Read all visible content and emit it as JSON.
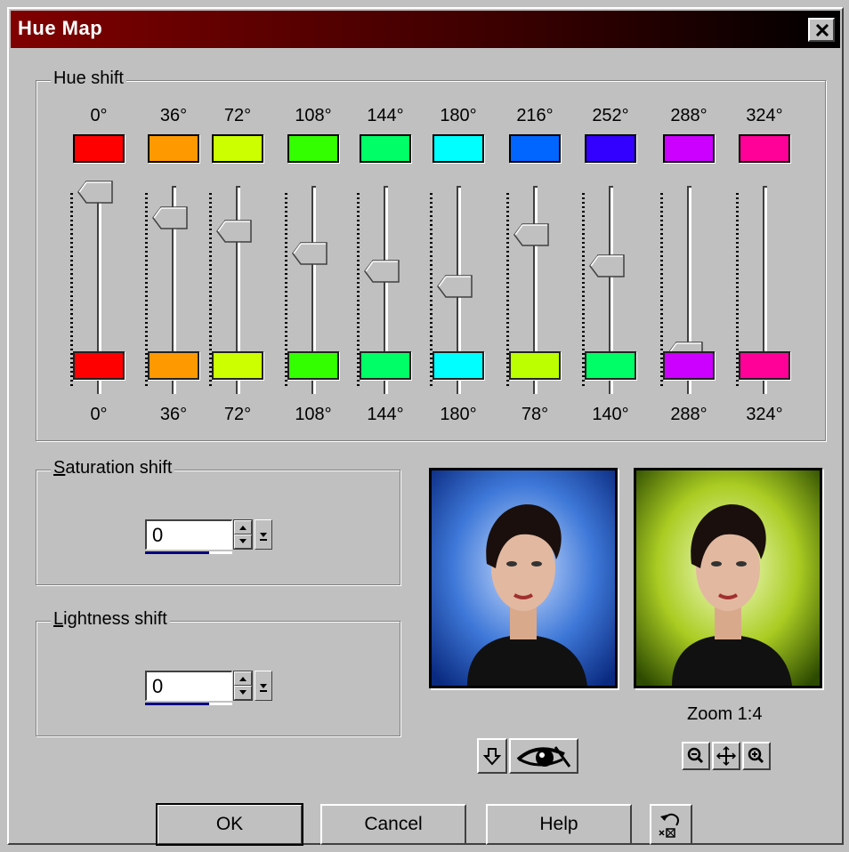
{
  "window": {
    "title": "Hue Map",
    "close_icon": "close-icon"
  },
  "hue_shift": {
    "legend": "Hue shift",
    "columns": [
      {
        "source_label": "0°",
        "source_color": "#ff0000",
        "target_label": "0°",
        "target_color": "#ff0000",
        "slider_level": 1.0
      },
      {
        "source_label": "36°",
        "source_color": "#ff9900",
        "target_label": "36°",
        "target_color": "#ff9900",
        "slider_level": 0.86
      },
      {
        "source_label": "72°",
        "source_color": "#ccff00",
        "target_label": "72°",
        "target_color": "#ccff00",
        "slider_level": 0.79
      },
      {
        "source_label": "108°",
        "source_color": "#33ff00",
        "target_label": "108°",
        "target_color": "#33ff00",
        "slider_level": 0.67
      },
      {
        "source_label": "144°",
        "source_color": "#00ff66",
        "target_label": "144°",
        "target_color": "#00ff66",
        "slider_level": 0.57
      },
      {
        "source_label": "180°",
        "source_color": "#00ffff",
        "target_label": "180°",
        "target_color": "#00ffff",
        "slider_level": 0.49
      },
      {
        "source_label": "216°",
        "source_color": "#0066ff",
        "target_label": "78°",
        "target_color": "#bbff00",
        "slider_level": 0.77
      },
      {
        "source_label": "252°",
        "source_color": "#3300ff",
        "target_label": "140°",
        "target_color": "#00ff66",
        "slider_level": 0.6
      },
      {
        "source_label": "288°",
        "source_color": "#cc00ff",
        "target_label": "288°",
        "target_color": "#cc00ff",
        "slider_level": 0.13
      },
      {
        "source_label": "324°",
        "source_color": "#ff0099",
        "target_label": "324°",
        "target_color": "#ff0099",
        "slider_level": 0.05
      }
    ]
  },
  "saturation": {
    "legend_first": "S",
    "legend_rest": "aturation shift",
    "value": "0"
  },
  "lightness": {
    "legend_first": "L",
    "legend_rest": "ightness shift",
    "value": "0"
  },
  "preview": {
    "zoom_label": "Zoom 1:4",
    "before_bg": "#1a4fbf",
    "after_bg": "#9fc21a"
  },
  "buttons": {
    "ok": "OK",
    "cancel": "Cancel",
    "help": "Help"
  },
  "icons": {
    "proof": "arrow-down-icon",
    "eye": "eye-icon",
    "zoom_out": "zoom-out-icon",
    "pan": "pan-icon",
    "zoom_in": "zoom-in-icon",
    "reset": "reset-icon"
  }
}
